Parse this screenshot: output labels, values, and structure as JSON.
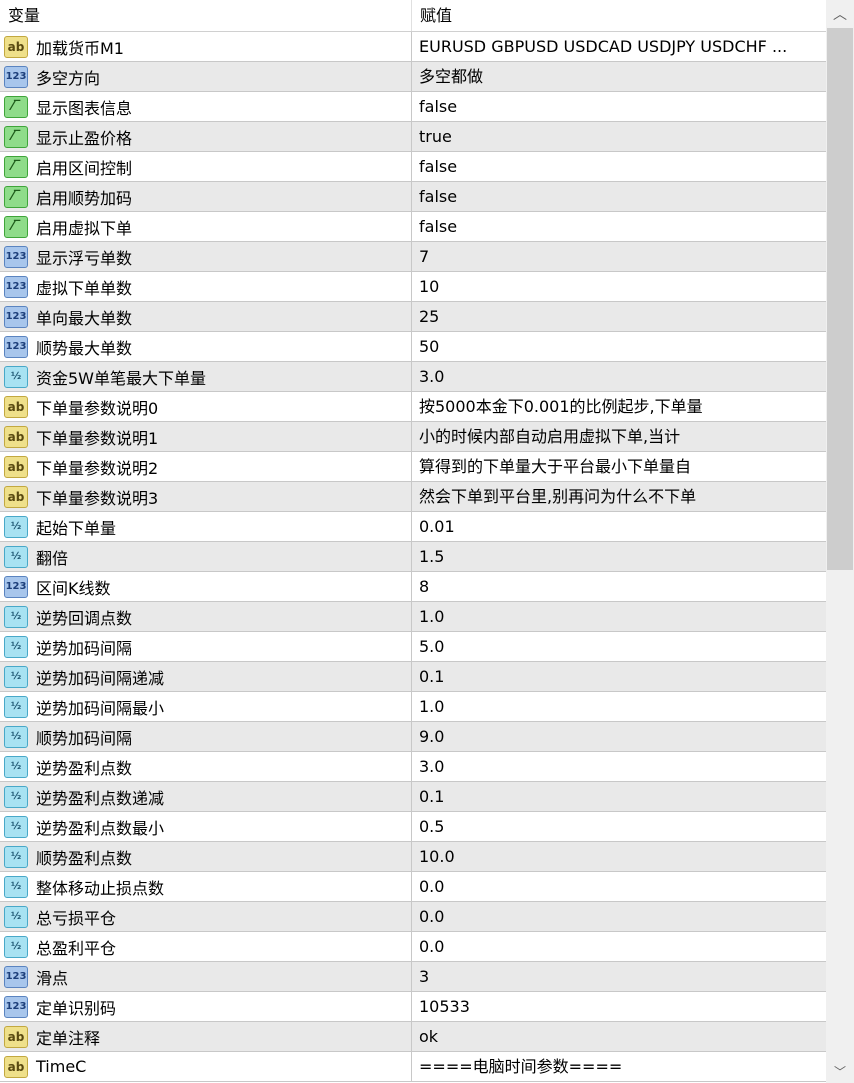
{
  "header": {
    "variable": "变量",
    "value": "赋值"
  },
  "rows": [
    {
      "type": "ab",
      "name": "加载货币M1",
      "value": "EURUSD GBPUSD USDCAD USDJPY USDCHF  ..."
    },
    {
      "type": "int",
      "name": "多空方向",
      "value": "多空都做"
    },
    {
      "type": "bool",
      "name": "显示图表信息",
      "value": "false"
    },
    {
      "type": "bool",
      "name": "显示止盈价格",
      "value": "true"
    },
    {
      "type": "bool",
      "name": "启用区间控制",
      "value": "false"
    },
    {
      "type": "bool",
      "name": "启用顺势加码",
      "value": "false"
    },
    {
      "type": "bool",
      "name": "启用虚拟下单",
      "value": "false"
    },
    {
      "type": "int",
      "name": "显示浮亏单数",
      "value": "7"
    },
    {
      "type": "int",
      "name": "虚拟下单单数",
      "value": "10"
    },
    {
      "type": "int",
      "name": "单向最大单数",
      "value": "25"
    },
    {
      "type": "int",
      "name": "顺势最大单数",
      "value": "50"
    },
    {
      "type": "dbl",
      "name": "资金5W单笔最大下单量",
      "value": "3.0"
    },
    {
      "type": "ab",
      "name": "下单量参数说明0",
      "value": "按5000本金下0.001的比例起步,下单量"
    },
    {
      "type": "ab",
      "name": "下单量参数说明1",
      "value": "小的时候内部自动启用虚拟下单,当计"
    },
    {
      "type": "ab",
      "name": "下单量参数说明2",
      "value": "算得到的下单量大于平台最小下单量自"
    },
    {
      "type": "ab",
      "name": "下单量参数说明3",
      "value": "然会下单到平台里,别再问为什么不下单"
    },
    {
      "type": "dbl",
      "name": "起始下单量",
      "value": "0.01"
    },
    {
      "type": "dbl",
      "name": "翻倍",
      "value": "1.5"
    },
    {
      "type": "int",
      "name": "区间K线数",
      "value": "8"
    },
    {
      "type": "dbl",
      "name": "逆势回调点数",
      "value": "1.0"
    },
    {
      "type": "dbl",
      "name": "逆势加码间隔",
      "value": "5.0"
    },
    {
      "type": "dbl",
      "name": "逆势加码间隔递减",
      "value": "0.1"
    },
    {
      "type": "dbl",
      "name": "逆势加码间隔最小",
      "value": "1.0"
    },
    {
      "type": "dbl",
      "name": "顺势加码间隔",
      "value": "9.0"
    },
    {
      "type": "dbl",
      "name": "逆势盈利点数",
      "value": "3.0"
    },
    {
      "type": "dbl",
      "name": "逆势盈利点数递减",
      "value": "0.1"
    },
    {
      "type": "dbl",
      "name": "逆势盈利点数最小",
      "value": "0.5"
    },
    {
      "type": "dbl",
      "name": "顺势盈利点数",
      "value": "10.0"
    },
    {
      "type": "dbl",
      "name": "整体移动止损点数",
      "value": "0.0"
    },
    {
      "type": "dbl",
      "name": "总亏损平仓",
      "value": "0.0"
    },
    {
      "type": "dbl",
      "name": "总盈利平仓",
      "value": "0.0"
    },
    {
      "type": "int",
      "name": "滑点",
      "value": "3"
    },
    {
      "type": "int",
      "name": "定单识别码",
      "value": "10533"
    },
    {
      "type": "ab",
      "name": "定单注释",
      "value": "ok"
    },
    {
      "type": "ab",
      "name": "TimeC",
      "value": "====电脑时间参数===="
    }
  ],
  "icon_labels": {
    "ab": "ab",
    "int": "123",
    "bool": "⁄‾",
    "dbl": "½"
  },
  "icon_names": {
    "ab": "string-type-icon",
    "int": "integer-type-icon",
    "bool": "boolean-type-icon",
    "dbl": "double-type-icon"
  }
}
